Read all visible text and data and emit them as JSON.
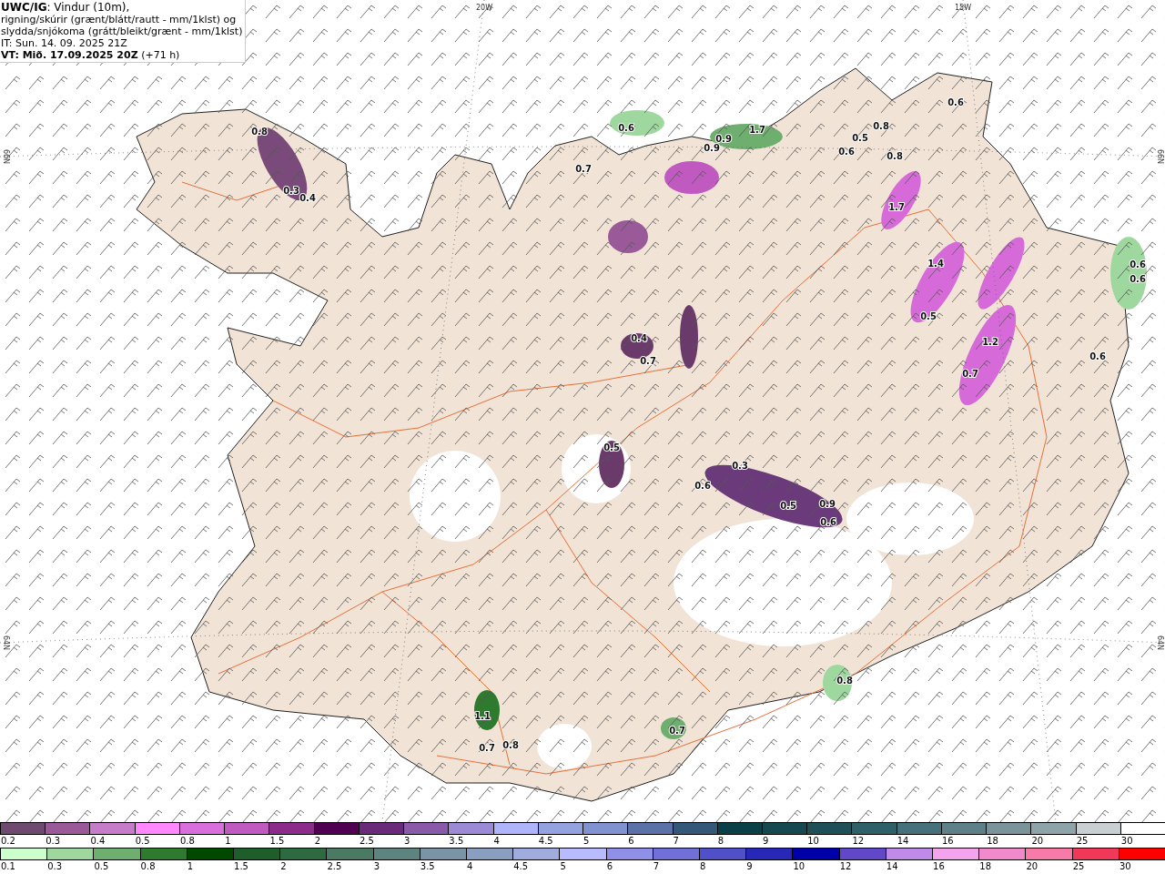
{
  "header": {
    "lines": [
      "**UWC/IG**: Vindur (10m),",
      "rigning/skúrir (grænt/blátt/rautt - mm/1klst) og",
      "slydda/snjókoma (grátt/bleikt/grænt - mm/1klst)",
      "IT: Sun. 14. 09. 2025 21Z",
      "**VT: Mið. 17.09.2025 20Z** (+71 h)"
    ]
  },
  "grid_labels": [
    "20W",
    "15W",
    "66N",
    "66N",
    "64N",
    "64N"
  ],
  "map_labels": [
    "0.8",
    "0.3",
    "0.4",
    "0.6",
    "0.9",
    "0.9",
    "1.7",
    "0.8",
    "0.5",
    "0.6",
    "0.8",
    "0.6",
    "0.6",
    "0.6",
    "0.7",
    "1.7",
    "1.4",
    "0.5",
    "0.4",
    "0.7",
    "0.5",
    "0.3",
    "0.6",
    "0.5",
    "0.9",
    "0.6",
    "0.7",
    "1.2",
    "0.8",
    "0.7",
    "1.1",
    "0.8",
    "0.7",
    "0.6"
  ],
  "legends": [
    {
      "items": [
        {
          "label": "0.2",
          "color": "#6e4a6e"
        },
        {
          "label": "0.3",
          "color": "#9a5a9a"
        },
        {
          "label": "0.4",
          "color": "#c77cc9"
        },
        {
          "label": "0.5",
          "color": "#ff88ff"
        },
        {
          "label": "0.8",
          "color": "#d96fdc"
        },
        {
          "label": "1",
          "color": "#c05ac0"
        },
        {
          "label": "1.5",
          "color": "#8b2b8b"
        },
        {
          "label": "2",
          "color": "#4f0050"
        },
        {
          "label": "2.5",
          "color": "#6a2a7a"
        },
        {
          "label": "3",
          "color": "#8a5aaa"
        },
        {
          "label": "3.5",
          "color": "#9d8ad6"
        },
        {
          "label": "4",
          "color": "#b0b4fa"
        },
        {
          "label": "4.5",
          "color": "#94a2e0"
        },
        {
          "label": "5",
          "color": "#8092d0"
        },
        {
          "label": "6",
          "color": "#5a72a8"
        },
        {
          "label": "7",
          "color": "#365878"
        },
        {
          "label": "8",
          "color": "#0a4048"
        },
        {
          "label": "9",
          "color": "#164850"
        },
        {
          "label": "10",
          "color": "#1f5058"
        },
        {
          "label": "12",
          "color": "#2e6068"
        },
        {
          "label": "14",
          "color": "#46707a"
        },
        {
          "label": "16",
          "color": "#5e8088"
        },
        {
          "label": "18",
          "color": "#7a949a"
        },
        {
          "label": "20",
          "color": "#8ea4a8"
        },
        {
          "label": "25",
          "color": "#c8d0d2"
        },
        {
          "label": "30",
          "color": "#ffffff"
        }
      ]
    },
    {
      "items": [
        {
          "label": "0.1",
          "color": "#ccffcc"
        },
        {
          "label": "0.3",
          "color": "#9ed89e"
        },
        {
          "label": "0.5",
          "color": "#6eae6e"
        },
        {
          "label": "0.8",
          "color": "#2e7a2e"
        },
        {
          "label": "1",
          "color": "#004a00"
        },
        {
          "label": "1.5",
          "color": "#1e5e2a"
        },
        {
          "label": "2",
          "color": "#2e6a40"
        },
        {
          "label": "2.5",
          "color": "#4a7a64"
        },
        {
          "label": "3",
          "color": "#5e8480"
        },
        {
          "label": "3.5",
          "color": "#7a94a6"
        },
        {
          "label": "4",
          "color": "#8a9ec0"
        },
        {
          "label": "4.5",
          "color": "#a0acde"
        },
        {
          "label": "5",
          "color": "#b8bcfe"
        },
        {
          "label": "6",
          "color": "#9090e8"
        },
        {
          "label": "7",
          "color": "#7070d8"
        },
        {
          "label": "8",
          "color": "#5050c8"
        },
        {
          "label": "9",
          "color": "#2828b8"
        },
        {
          "label": "10",
          "color": "#0000a8"
        },
        {
          "label": "12",
          "color": "#6048c8"
        },
        {
          "label": "14",
          "color": "#c08ae8"
        },
        {
          "label": "16",
          "color": "#f4a4ec"
        },
        {
          "label": "18",
          "color": "#f08acc"
        },
        {
          "label": "20",
          "color": "#f87aa8"
        },
        {
          "label": "25",
          "color": "#f03858"
        },
        {
          "label": "30",
          "color": "#ff0000"
        }
      ]
    }
  ]
}
